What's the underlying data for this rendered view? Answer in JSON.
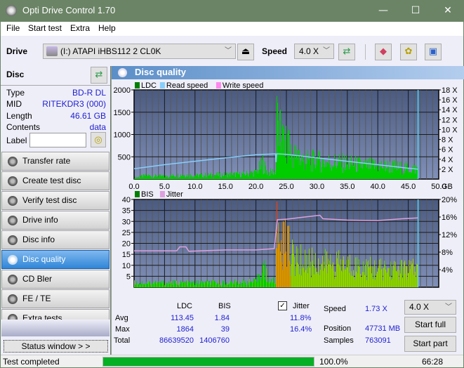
{
  "window": {
    "title": "Opti Drive Control 1.70",
    "minimize": "—",
    "maximize": "☐",
    "close": "✕"
  },
  "menu": [
    "File",
    "Start test",
    "Extra",
    "Help"
  ],
  "toolbar": {
    "drive_label": "Drive",
    "drive_value": "(I:)  ATAPI iHBS112   2 CL0K",
    "speed_label": "Speed",
    "speed_value": "4.0 X"
  },
  "disc": {
    "header": "Disc",
    "type_label": "Type",
    "type_value": "BD-R DL",
    "mid_label": "MID",
    "mid_value": "RITEKDR3 (000)",
    "length_label": "Length",
    "length_value": "46.61 GB",
    "contents_label": "Contents",
    "contents_value": "data",
    "label_label": "Label",
    "label_value": ""
  },
  "nav": [
    {
      "label": "Transfer rate",
      "active": false
    },
    {
      "label": "Create test disc",
      "active": false
    },
    {
      "label": "Verify test disc",
      "active": false
    },
    {
      "label": "Drive info",
      "active": false
    },
    {
      "label": "Disc info",
      "active": false
    },
    {
      "label": "Disc quality",
      "active": true
    },
    {
      "label": "CD Bler",
      "active": false
    },
    {
      "label": "FE / TE",
      "active": false
    },
    {
      "label": "Extra tests",
      "active": false
    }
  ],
  "status_window_label": "Status window > >",
  "panel_title": "Disc quality",
  "chart_data": [
    {
      "type": "bar",
      "title": "LDC",
      "legend": [
        "LDC",
        "Read speed",
        "Write speed"
      ],
      "legend_colors": [
        "#008000",
        "#87cefa",
        "#ff88ee"
      ],
      "xlabel": "GB",
      "x_ticks": [
        "0.0",
        "5.0",
        "10.0",
        "15.0",
        "20.0",
        "25.0",
        "30.0",
        "35.0",
        "40.0",
        "45.0",
        "50.0"
      ],
      "xlim": [
        0,
        50
      ],
      "y_ticks": [
        "500",
        "1000",
        "1500",
        "2000"
      ],
      "ylim": [
        0,
        2000
      ],
      "y2_ticks": [
        "2 X",
        "4 X",
        "6 X",
        "8 X",
        "10 X",
        "12 X",
        "14 X",
        "16 X",
        "18 X"
      ],
      "y2lim": [
        0,
        18
      ],
      "end_marker_gb": 46.61,
      "ldc_profile": [
        [
          0,
          30
        ],
        [
          2,
          80
        ],
        [
          5,
          60
        ],
        [
          8,
          100
        ],
        [
          10,
          80
        ],
        [
          12,
          90
        ],
        [
          15,
          100
        ],
        [
          18,
          110
        ],
        [
          20,
          150
        ],
        [
          21,
          350
        ],
        [
          22,
          140
        ],
        [
          23.2,
          180
        ],
        [
          23.4,
          1200
        ],
        [
          24,
          950
        ],
        [
          25,
          700
        ],
        [
          26,
          550
        ],
        [
          28,
          420
        ],
        [
          30,
          400
        ],
        [
          32,
          380
        ],
        [
          35,
          350
        ],
        [
          38,
          300
        ],
        [
          40,
          300
        ],
        [
          42,
          280
        ],
        [
          44,
          250
        ],
        [
          46.6,
          230
        ]
      ],
      "ldc_peaks": [
        [
          23.4,
          1864
        ],
        [
          25.3,
          1100
        ],
        [
          24.3,
          1230
        ],
        [
          21.1,
          540
        ],
        [
          27,
          650
        ],
        [
          30,
          500
        ]
      ],
      "read_speed": [
        [
          0,
          2.1
        ],
        [
          5,
          2.9
        ],
        [
          10,
          3.6
        ],
        [
          15,
          4.3
        ],
        [
          20,
          4.9
        ],
        [
          23.2,
          5.1
        ],
        [
          23.3,
          3.4
        ],
        [
          23.4,
          5.1
        ],
        [
          25,
          5.0
        ],
        [
          30,
          4.3
        ],
        [
          35,
          3.6
        ],
        [
          40,
          2.9
        ],
        [
          45,
          2.2
        ],
        [
          46.6,
          2.0
        ]
      ]
    },
    {
      "type": "bar",
      "title": "BIS",
      "legend": [
        "BIS",
        "Jitter"
      ],
      "legend_colors": [
        "#008000",
        "#dda0dd"
      ],
      "xlabel": "GB",
      "x_ticks": [
        "0.0",
        "5.0",
        "10.0",
        "15.0",
        "20.0",
        "25.0",
        "30.0",
        "35.0",
        "40.0",
        "45.0",
        "50.0"
      ],
      "xlim": [
        0,
        50
      ],
      "y_ticks": [
        "5",
        "10",
        "15",
        "20",
        "25",
        "30",
        "35",
        "40"
      ],
      "ylim": [
        0,
        40
      ],
      "y2_ticks": [
        "4%",
        "8%",
        "12%",
        "16%",
        "20%"
      ],
      "y2lim": [
        0,
        20
      ],
      "end_marker_gb": 46.61,
      "bis_profile": [
        [
          0,
          2
        ],
        [
          5,
          2
        ],
        [
          10,
          2
        ],
        [
          15,
          2
        ],
        [
          20,
          2.5
        ],
        [
          21.1,
          10
        ],
        [
          22,
          3
        ],
        [
          23.2,
          3
        ],
        [
          23.4,
          25
        ],
        [
          24,
          21
        ],
        [
          25,
          19
        ],
        [
          25.5,
          14
        ],
        [
          27,
          12
        ],
        [
          30,
          11
        ],
        [
          35,
          10
        ],
        [
          40,
          8
        ],
        [
          45,
          8
        ],
        [
          46.6,
          8
        ]
      ],
      "bis_peaks": [
        [
          23.4,
          39
        ],
        [
          25.3,
          28
        ],
        [
          21.1,
          11
        ]
      ],
      "jitter": [
        [
          0,
          8.3
        ],
        [
          7,
          8.3
        ],
        [
          7.5,
          9.2
        ],
        [
          8.5,
          9.2
        ],
        [
          9,
          8.2
        ],
        [
          15,
          8.5
        ],
        [
          20,
          8.5
        ],
        [
          23,
          8.8
        ],
        [
          23.3,
          12.5
        ],
        [
          23.5,
          15.4
        ],
        [
          25,
          15.5
        ],
        [
          28,
          16.0
        ],
        [
          30.5,
          16.4
        ],
        [
          31,
          15.6
        ],
        [
          35,
          15.3
        ],
        [
          40,
          15.2
        ],
        [
          44,
          15.6
        ],
        [
          46.6,
          15.8
        ]
      ]
    }
  ],
  "stats": {
    "col_ldc": "LDC",
    "col_bis": "BIS",
    "avg_label": "Avg",
    "avg_ldc": "113.45",
    "avg_bis": "1.84",
    "max_label": "Max",
    "max_ldc": "1864",
    "max_bis": "39",
    "total_label": "Total",
    "total_ldc": "86639520",
    "total_bis": "1406760",
    "jitter_label": "Jitter",
    "jitter_checked": true,
    "jitter_avg": "11.8%",
    "jitter_max": "16.4%",
    "speed_label": "Speed",
    "speed_value": "1.73 X",
    "position_label": "Position",
    "position_value": "47731 MB",
    "samples_label": "Samples",
    "samples_value": "763091",
    "speed_select": "4.0 X",
    "start_full": "Start full",
    "start_part": "Start part"
  },
  "statusbar": {
    "text": "Test completed",
    "progress": 100,
    "progress_text": "100.0%",
    "time": "66:28"
  }
}
